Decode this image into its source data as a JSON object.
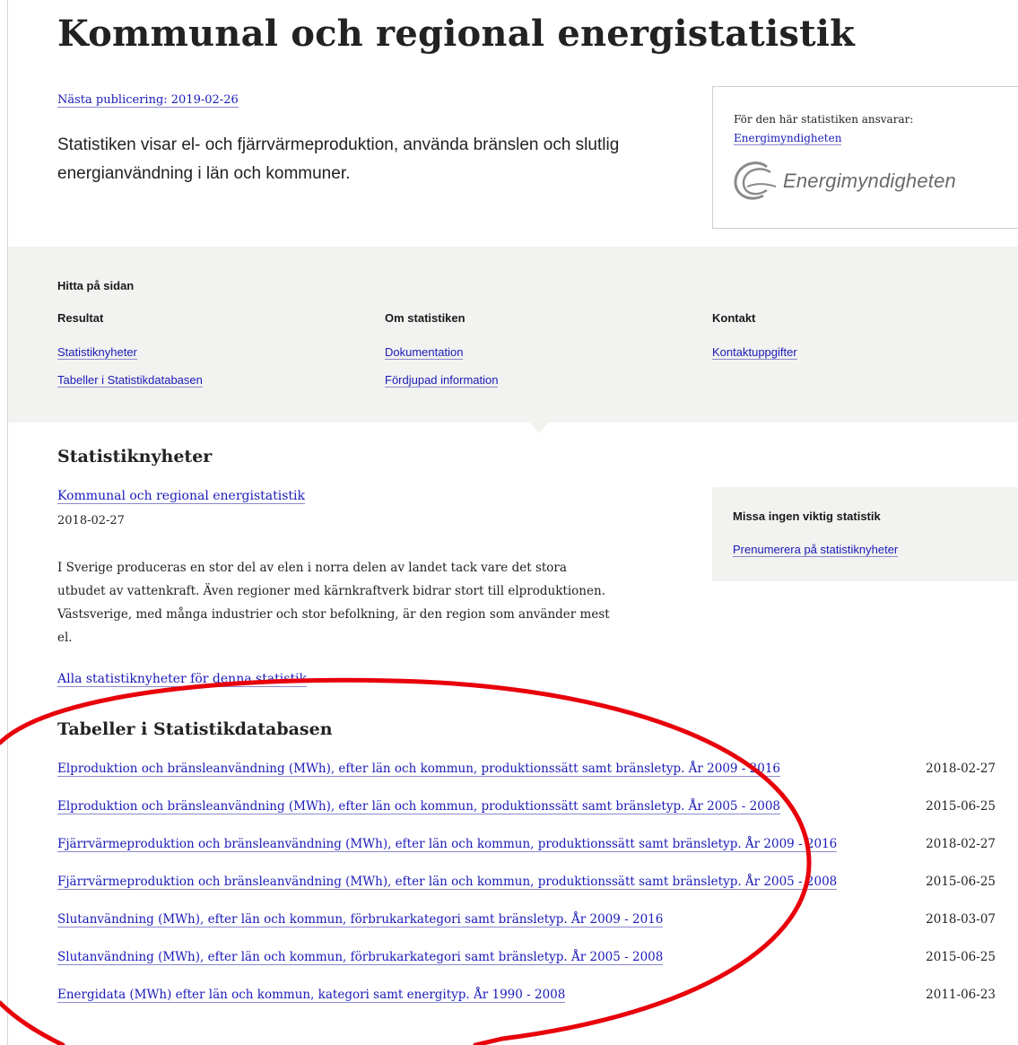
{
  "page_title": "Kommunal och regional energistatistik",
  "next_publication": "Nästa publicering: 2019-02-26",
  "intro": "Statistiken visar el- och fjärrvärmeproduktion, använda bränslen och slutlig energianvändning i län och kommuner.",
  "responsible": {
    "label": "För den här statistiken ansvarar:",
    "link": "Energimyndigheten",
    "logo_text": "Energimyndigheten",
    "logo_icon": "energimyndigheten-logo-icon"
  },
  "find_on_page": {
    "title": "Hitta på sidan",
    "columns": [
      {
        "heading": "Resultat",
        "links": [
          "Statistiknyheter",
          "Tabeller i Statistikdatabasen"
        ]
      },
      {
        "heading": "Om statistiken",
        "links": [
          "Dokumentation",
          "Fördjupad information"
        ]
      },
      {
        "heading": "Kontakt",
        "links": [
          "Kontaktuppgifter"
        ]
      }
    ]
  },
  "news": {
    "heading": "Statistiknyheter",
    "item_title": "Kommunal och regional energistatistik",
    "item_date": "2018-02-27",
    "item_text": "I Sverige produceras en stor del av elen i norra delen av landet tack vare det stora utbudet av vattenkraft. Även regioner med kärnkraftverk bidrar stort till elproduktionen. Västsverige, med många industrier och stor befolkning, är den region som använder mest el.",
    "all_link": "Alla statistiknyheter för denna statistik"
  },
  "subscribe": {
    "title": "Missa ingen viktig statistik",
    "link": "Prenumerera på statistiknyheter"
  },
  "tables": {
    "heading": "Tabeller i Statistikdatabasen",
    "rows": [
      {
        "title": "Elproduktion och bränsleanvändning (MWh), efter län och kommun, produktionssätt samt bränsletyp. År 2009 - 2016",
        "date": "2018-02-27"
      },
      {
        "title": "Elproduktion och bränsleanvändning (MWh), efter län och kommun, produktionssätt samt bränsletyp. År 2005 - 2008",
        "date": "2015-06-25"
      },
      {
        "title": "Fjärrvärmeproduktion och bränsleanvändning (MWh), efter län och kommun, produktionssätt samt bränsletyp. År 2009 - 2016",
        "date": "2018-02-27"
      },
      {
        "title": "Fjärrvärmeproduktion och bränsleanvändning (MWh), efter län och kommun, produktionssätt samt bränsletyp. År 2005 - 2008",
        "date": "2015-06-25"
      },
      {
        "title": "Slutanvändning (MWh), efter län och kommun, förbrukarkategori samt bränsletyp. År 2009 - 2016",
        "date": "2018-03-07"
      },
      {
        "title": "Slutanvändning (MWh), efter län och kommun, förbrukarkategori samt bränsletyp. År 2005 - 2008",
        "date": "2015-06-25"
      },
      {
        "title": "Energidata (MWh) efter län och kommun, kategori samt energityp. År 1990 - 2008",
        "date": "2011-06-23"
      }
    ]
  },
  "annotation": {
    "color": "#e8000b",
    "shape": "ellipse"
  },
  "colors": {
    "link": "#1a1ab8",
    "band": "#f2f2f0",
    "border": "#cfcfcf"
  }
}
